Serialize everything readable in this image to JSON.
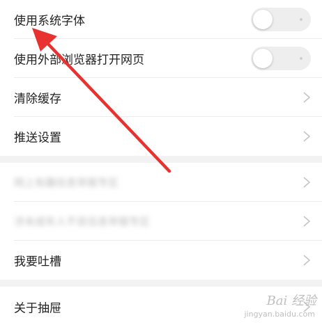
{
  "settings": {
    "group1": [
      {
        "label": "使用系统字体",
        "type": "toggle",
        "enabled": false
      },
      {
        "label": "使用外部浏览器打开网页",
        "type": "toggle",
        "enabled": false
      },
      {
        "label": "清除缓存",
        "type": "link"
      },
      {
        "label": "推送设置",
        "type": "link"
      }
    ],
    "group2": [
      {
        "label": "网上有趣信息举报专区",
        "type": "link",
        "blurred": true
      },
      {
        "label": "涉未成年人不良信息举报专区",
        "type": "link",
        "blurred": true
      },
      {
        "label": "我要吐槽",
        "type": "link"
      }
    ],
    "group3": [
      {
        "label": "关于抽屉",
        "type": "link"
      }
    ]
  },
  "watermark": {
    "text": "Bai 经验",
    "sub": "jingyan.baidu.com"
  },
  "colors": {
    "annotation_arrow": "#e8322f",
    "section_gap": "#f2f2f2",
    "row_text": "#222222",
    "toggle_track": "#eeeeee"
  }
}
